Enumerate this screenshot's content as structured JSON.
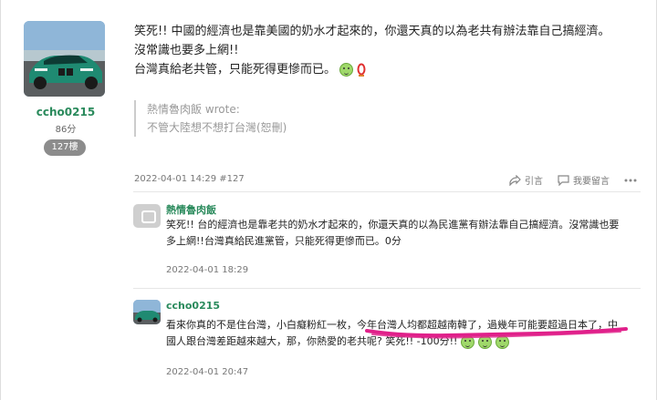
{
  "author": {
    "username": "ccho0215",
    "points": "86分",
    "floor_badge": "127樓"
  },
  "post": {
    "lines": [
      "笑死!! 中國的經濟也是靠美國的奶水才起來的，你還天真的以為老共有辦法靠自己搞經濟。",
      "沒常識也要多上網!!",
      "台灣真給老共管，只能死得更慘而已。"
    ],
    "quote_header": "熱情魯肉飯 wrote:",
    "quote_body": "不管大陸想不想打台灣(恕刪)",
    "meta": "2022-04-01 14:29 #127",
    "actions": {
      "cite": "引言",
      "comment": "我要留言"
    }
  },
  "comments": [
    {
      "name": "熱情魯肉飯",
      "text_line1": "笑死!! 台的經濟也是靠老共的奶水才起來的，你還天真的以為民進黨有辦法靠自己搞經濟。沒常識也要",
      "text_line2": "多上網!!台灣真給民進黨管，只能死得更慘而已。0分",
      "date": "2022-04-01 18:29"
    },
    {
      "name": "ccho0215",
      "text_line1": "看來你真的不是住台灣，小白癡粉紅一枚，今年台灣人均都超越南韓了，過幾年可能要超過日本了，中",
      "text_line2": "國人跟台灣差距越來越大，那，你熱愛的老共呢? 笑死!! -100分!!",
      "date": "2022-04-01 20:47"
    }
  ],
  "colors": {
    "username_green": "#2a8a5c",
    "highlight_scribble": "#e0208a"
  },
  "icons": {
    "cite": "share-link-icon",
    "comment": "speech-bubble-icon",
    "more": "more-dots-icon"
  }
}
